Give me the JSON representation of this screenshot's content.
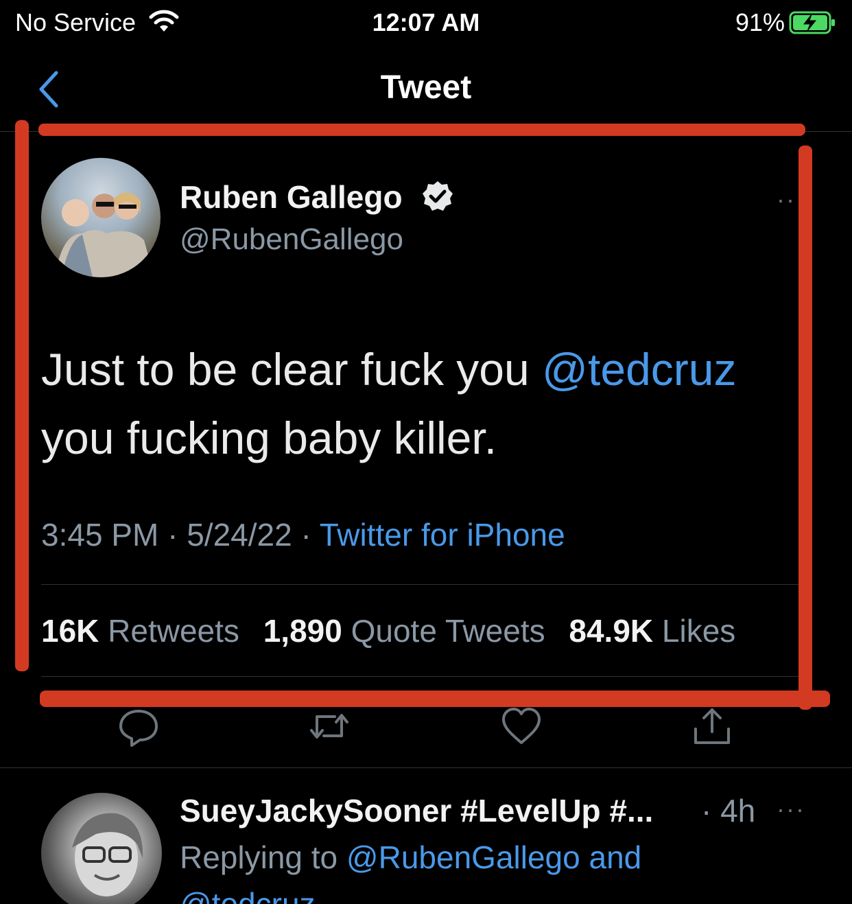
{
  "status_bar": {
    "carrier": "No Service",
    "time": "12:07 AM",
    "battery": "91%"
  },
  "nav": {
    "title": "Tweet"
  },
  "tweet": {
    "author_name": "Ruben Gallego",
    "author_handle": "@RubenGallego",
    "more_label": "···",
    "text_line1": "Just to be clear fuck you ",
    "mention": "@tedcruz",
    "text_line2": "you fucking baby killer.",
    "time": "3:45 PM",
    "date": "5/24/22",
    "separator": " · ",
    "source": "Twitter for iPhone",
    "stats": {
      "retweets_count": "16K",
      "retweets_label": "Retweets",
      "quotes_count": "1,890",
      "quotes_label": "Quote Tweets",
      "likes_count": "84.9K",
      "likes_label": "Likes"
    }
  },
  "reply": {
    "name": "SueyJackySooner #LevelUp #...",
    "time": "· 4h",
    "more_label": "···",
    "replying_prefix": "Replying to ",
    "replying_to": "@RubenGallego and",
    "replying_to_clipped": "@tedcruz"
  },
  "colors": {
    "accent": "#4a99e9",
    "annotation": "#d33a22",
    "battery": "#4cd964"
  }
}
